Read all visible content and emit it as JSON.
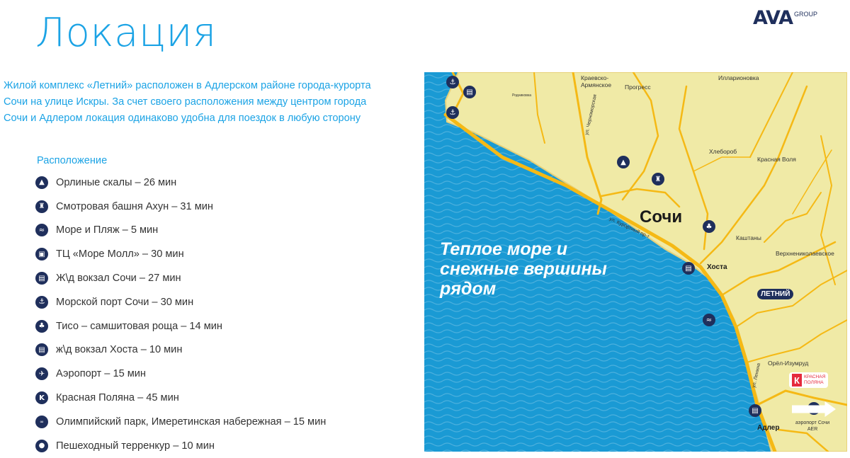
{
  "header": {
    "title": "Локация",
    "logo": {
      "main": "AVA",
      "sub": "GROUP"
    }
  },
  "intro_lines": [
    "Жилой комплекс «Летний» расположен в Адлерском районе города-курорта",
    "Сочи на улице Искры. За счет своего расположения между центром города",
    "Сочи и Адлером локация одинаково удобна для поездок в любую сторону"
  ],
  "location": {
    "title": "Расположение",
    "items": [
      {
        "icon": "mountain-icon",
        "text": "Орлиные скалы – 26 мин"
      },
      {
        "icon": "tower-icon",
        "text": "Смотровая башня Ахун – 31 мин"
      },
      {
        "icon": "waves-icon",
        "text": "Море и Пляж – 5 мин"
      },
      {
        "icon": "shopping-bag-icon",
        "text": "ТЦ «Море Молл» – 30 мин"
      },
      {
        "icon": "train-icon",
        "text": "Ж\\д вокзал Сочи – 27 мин"
      },
      {
        "icon": "anchor-icon",
        "text": "Морской порт Сочи – 30 мин"
      },
      {
        "icon": "tree-icon",
        "text": "Тисо – самшитовая роща – 14 мин"
      },
      {
        "icon": "train-icon",
        "text": "ж\\д вокзал Хоста – 10 мин"
      },
      {
        "icon": "airplane-icon",
        "text": "Аэропорт – 15 мин"
      },
      {
        "icon": "k-logo-icon",
        "text": "Красная Поляна – 45 мин"
      },
      {
        "icon": "olympic-rings-icon",
        "text": "Олимпийский парк, Имеретинская набережная – 15 мин"
      },
      {
        "icon": "pin-icon",
        "text": "Пешеходный терренкур – 10 мин"
      }
    ]
  },
  "map": {
    "headline": [
      "Теплое море и",
      "снежные вершины",
      "рядом"
    ],
    "city": "Сочи",
    "places": {
      "kraevsko": [
        "Краевско-",
        "Армянское"
      ],
      "progress": "Прогресс",
      "illarionovka": "Илларионовка",
      "khleborob": "Хлебороб",
      "krasnaya_volya": "Красная Воля",
      "kashtany": "Каштаны",
      "verkhnenikolaevskoe": "Верхнениколаевское",
      "khosta": "Хоста",
      "orel_izumrud": "Орёл-Изумруд",
      "adler": "Адлер",
      "airport": [
        "аэропорт Сочи",
        "AER"
      ],
      "rodnikovka": "Родниковка"
    },
    "streets": {
      "kurortny": "ул. Курортный пр-т",
      "chernomorskaya": "ул. Черноморская",
      "lenina": "ул. Ленина"
    },
    "letniy_badge": "ЛЕТНИЙ",
    "krasnaya_polyana": {
      "k": "К",
      "line1": "КРАСНАЯ",
      "line2": "ПОЛЯНА"
    },
    "colors": {
      "sea": "#1a9ad4",
      "land": "#f0eaa6",
      "roads": "#f5b915",
      "icons": "#1f2f5c"
    }
  }
}
